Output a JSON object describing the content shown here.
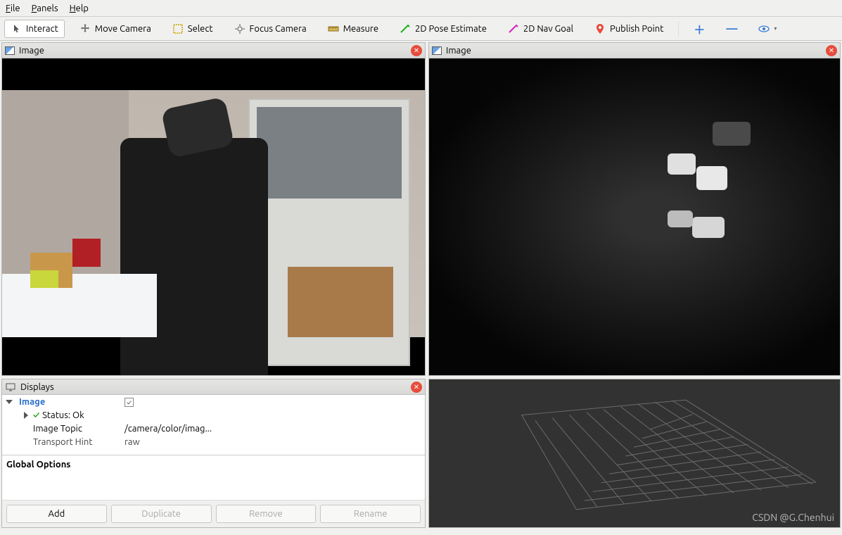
{
  "menubar": {
    "file": "File",
    "panels": "Panels",
    "help": "Help"
  },
  "toolbar": {
    "interact": "Interact",
    "move_camera": "Move Camera",
    "select": "Select",
    "focus_camera": "Focus Camera",
    "measure": "Measure",
    "pose_estimate": "2D Pose Estimate",
    "nav_goal": "2D Nav Goal",
    "publish_point": "Publish Point"
  },
  "panels": {
    "image_left_title": "Image",
    "image_right_title": "Image",
    "displays_title": "Displays"
  },
  "displays": {
    "tree": {
      "image_label": "Image",
      "image_checked": "✓",
      "status_label": "Status: Ok",
      "image_topic_label": "Image Topic",
      "image_topic_value": "/camera/color/imag...",
      "transport_hint_label": "Transport Hint",
      "transport_hint_value": "raw"
    },
    "description_title": "Global Options",
    "buttons": {
      "add": "Add",
      "duplicate": "Duplicate",
      "remove": "Remove",
      "rename": "Rename"
    }
  },
  "watermark": "CSDN @G.Chenhui"
}
